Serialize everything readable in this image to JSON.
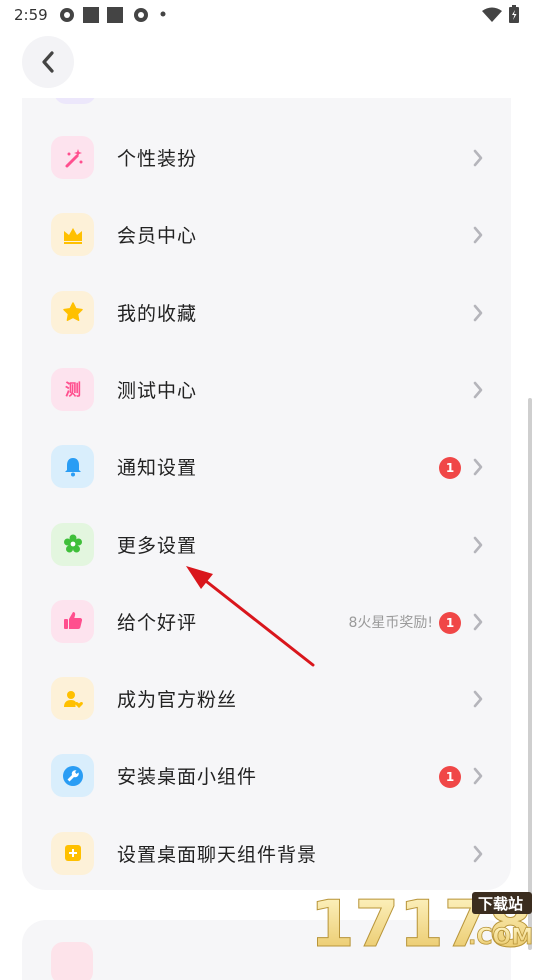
{
  "status_bar": {
    "time": "2:59"
  },
  "menu": {
    "items": [
      {
        "label": "个性装扮",
        "icon": "magic-wand-icon",
        "bg": "#fde3ee",
        "color": "#ff4f8e"
      },
      {
        "label": "会员中心",
        "icon": "crown-icon",
        "bg": "#fdf1d8",
        "color": "#ffc000"
      },
      {
        "label": "我的收藏",
        "icon": "star-icon",
        "bg": "#fdf1d8",
        "color": "#ffc000"
      },
      {
        "label": "测试中心",
        "icon": "test-icon",
        "bg": "#fde3ee",
        "color": "#ff4f8e",
        "glyph": "测"
      },
      {
        "label": "通知设置",
        "icon": "bell-icon",
        "bg": "#d9eefc",
        "color": "#2a9df4",
        "badge": "1"
      },
      {
        "label": "更多设置",
        "icon": "flower-gear-icon",
        "bg": "#e3f6df",
        "color": "#3fbf3a"
      },
      {
        "label": "给个好评",
        "icon": "thumbs-up-icon",
        "bg": "#fde3ee",
        "color": "#ff4f8e",
        "badge": "1",
        "hint": "8火星币奖励!"
      },
      {
        "label": "成为官方粉丝",
        "icon": "user-heart-icon",
        "bg": "#fdf1d8",
        "color": "#ffc000"
      },
      {
        "label": "安装桌面小组件",
        "icon": "wrench-icon",
        "bg": "#d9eefc",
        "color": "#2a9df4",
        "badge": "1"
      },
      {
        "label": "设置桌面聊天组件背景",
        "icon": "image-plus-icon",
        "bg": "#fdf1d8",
        "color": "#ffc000"
      }
    ]
  },
  "watermark": {
    "number": "17178",
    "site": "下载站",
    "domain": ".COM"
  }
}
